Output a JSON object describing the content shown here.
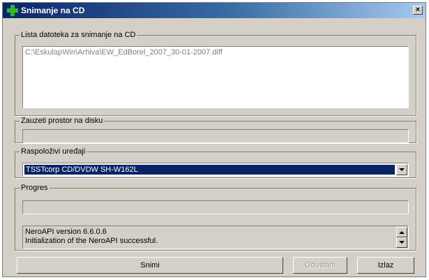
{
  "window": {
    "title": "Snimanje na CD",
    "close_glyph": "×"
  },
  "files_group": {
    "legend": "Lista datoteka za snimanje na CD",
    "items": [
      "C:\\EskulapWin\\Arhiva\\EW_EdBorel_2007_30-01-2007.diff"
    ]
  },
  "space_group": {
    "legend": "Zauzeti prostor na disku"
  },
  "devices_group": {
    "legend": "Raspoloživi uređaji",
    "selected": "TSSTcorp CD/DVDW SH-W162L"
  },
  "progress_group": {
    "legend": "Progres",
    "log": [
      "NeroAPI version 6.6.0.6",
      "Initialization of the NeroAPI successful."
    ]
  },
  "buttons": {
    "snimi": "Snimi",
    "odustani": "Odustani",
    "izlaz": "Izlaz"
  },
  "icons": {
    "app": "green-plus-icon",
    "close": "close-icon",
    "dropdown": "chevron-down-icon",
    "scroll_up": "arrow-up-icon",
    "scroll_down": "arrow-down-icon"
  }
}
